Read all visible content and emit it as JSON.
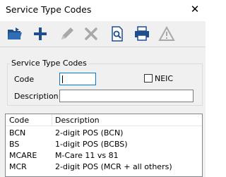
{
  "window": {
    "title": "Service Type Codes"
  },
  "toolbar": {
    "buttons": [
      {
        "icon": "open-folder-icon",
        "enabled": true
      },
      {
        "icon": "add-icon",
        "enabled": true
      },
      {
        "icon": "edit-pencil-icon",
        "enabled": false
      },
      {
        "icon": "delete-x-icon",
        "enabled": false
      },
      {
        "icon": "preview-document-icon",
        "enabled": true
      },
      {
        "icon": "printer-icon",
        "enabled": true
      },
      {
        "icon": "warning-icon",
        "enabled": false
      }
    ]
  },
  "filter": {
    "group_title": "Service Type Codes",
    "code_label": "Code",
    "code_value": "",
    "neic_label": "NEIC",
    "neic_checked": false,
    "description_label": "Description",
    "description_value": ""
  },
  "list": {
    "columns": [
      "Code",
      "Description"
    ],
    "rows": [
      {
        "code": "BCN",
        "description": "2-digit POS (BCN)"
      },
      {
        "code": "BS",
        "description": "1-digit POS (BCBS)"
      },
      {
        "code": "MCARE",
        "description": "M-Care 11 vs 81"
      },
      {
        "code": "MCR",
        "description": "2-digit POS (MCR + all others)"
      }
    ]
  },
  "colors": {
    "accent": "#1e4e8c",
    "disabled": "#a8a8a8",
    "focus_border": "#0078d7"
  }
}
